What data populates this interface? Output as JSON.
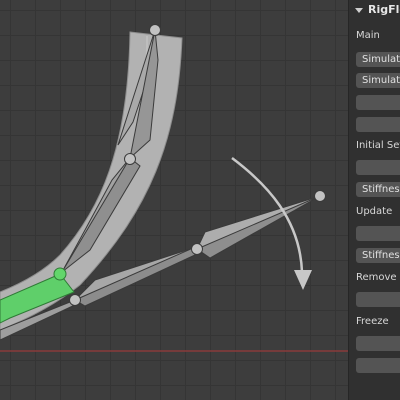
{
  "panel": {
    "title": "RigFlex",
    "sections": {
      "main": "Main",
      "initial_setup": "Initial Setu",
      "update": "Update",
      "remove": "Remove",
      "freeze": "Freeze"
    },
    "buttons": {
      "simulation_1": "Simulati",
      "simulation_2": "Simulati",
      "stiffness_1": "Stiffnes",
      "stiffness_2": "Stiffnes"
    }
  },
  "colors": {
    "active_bone": "#5fcf6a",
    "bone": "#9a9a9a",
    "mesh": "#b4b4b4",
    "grid_bg": "#3d3d3d",
    "x_axis": "#8a3b3b",
    "panel_bg": "#303030",
    "button": "#545454"
  }
}
